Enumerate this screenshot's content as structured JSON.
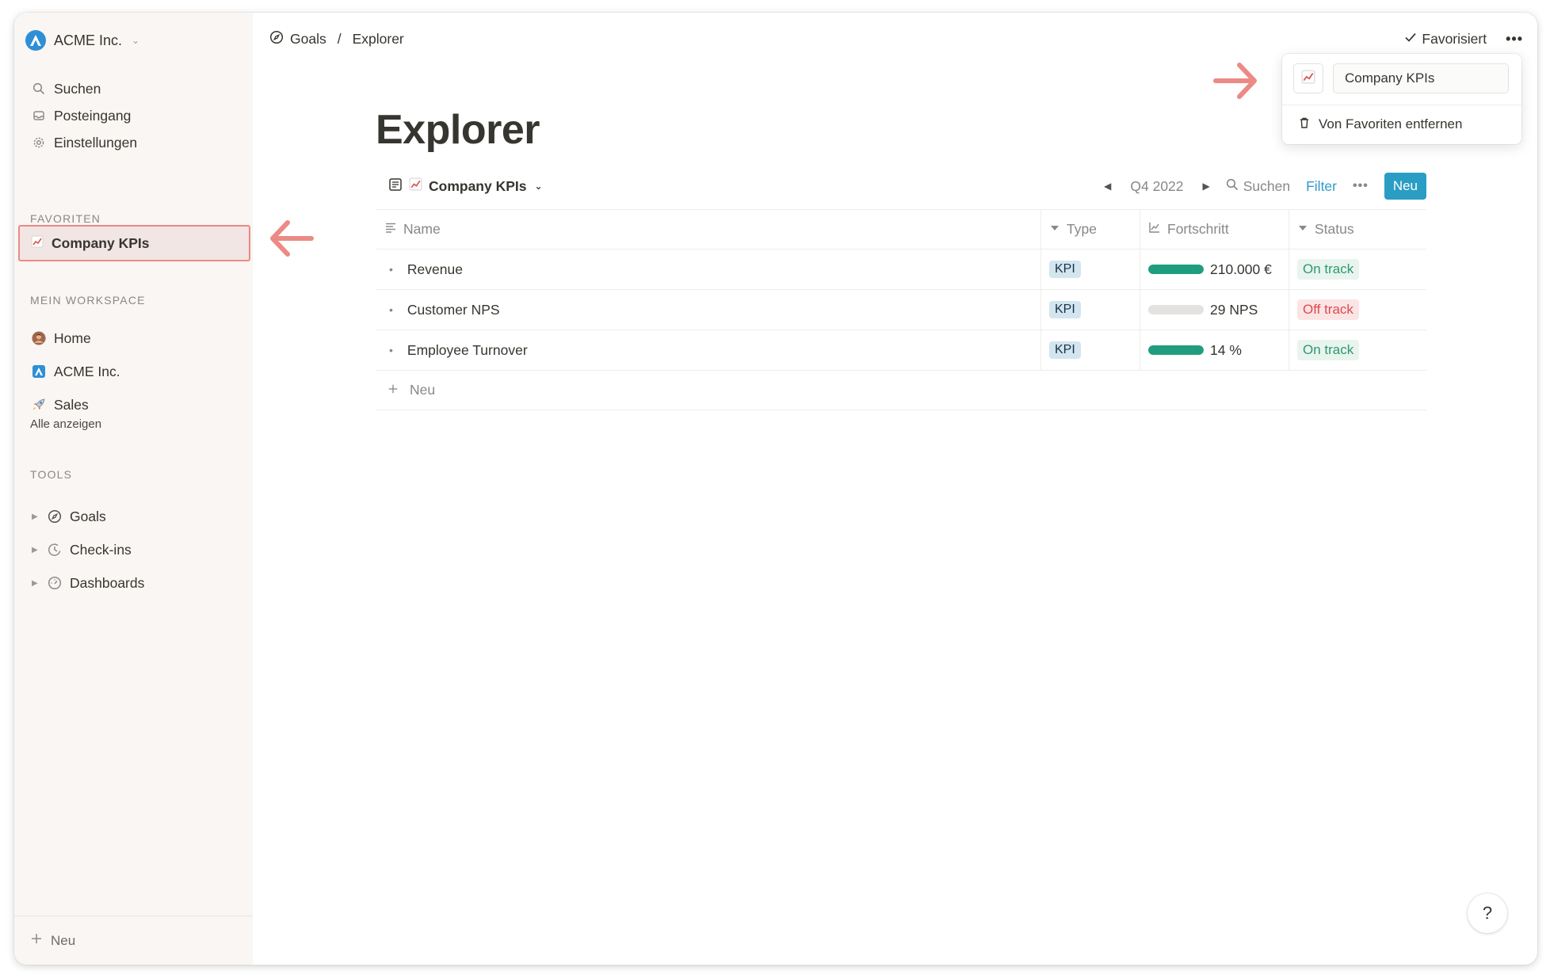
{
  "workspace": {
    "name": "ACME Inc.",
    "logo_letter": "A"
  },
  "sidebar": {
    "nav": [
      {
        "label": "Suchen",
        "icon": "search-icon"
      },
      {
        "label": "Posteingang",
        "icon": "inbox-icon"
      },
      {
        "label": "Einstellungen",
        "icon": "gear-icon"
      }
    ],
    "favorites_label": "FAVORITEN",
    "favorites": [
      {
        "label": "Company KPIs",
        "icon": "chart-up-icon"
      }
    ],
    "workspace_label": "MEIN WORKSPACE",
    "workspace_items": [
      {
        "label": "Home",
        "icon": "avatar-icon"
      },
      {
        "label": "ACME Inc.",
        "icon": "acme-logo-icon"
      },
      {
        "label": "Sales",
        "icon": "rocket-icon"
      }
    ],
    "show_all": "Alle anzeigen",
    "tools_label": "TOOLS",
    "tools": [
      {
        "label": "Goals",
        "icon": "compass-icon"
      },
      {
        "label": "Check-ins",
        "icon": "clock-icon"
      },
      {
        "label": "Dashboards",
        "icon": "gauge-icon"
      }
    ],
    "new_label": "Neu"
  },
  "header": {
    "breadcrumb": [
      {
        "label": "Goals",
        "icon": "compass-icon"
      },
      {
        "label": "Explorer"
      }
    ],
    "separator": "/",
    "favorited_label": "Favorisiert"
  },
  "popover": {
    "name_value": "Company KPIs",
    "remove_label": "Von Favoriten entfernen"
  },
  "page": {
    "title": "Explorer",
    "view_name": "Company KPIs",
    "period": "Q4 2022",
    "search_label": "Suchen",
    "filter_label": "Filter",
    "new_label": "Neu"
  },
  "table": {
    "columns": [
      {
        "label": "Name",
        "icon": "lines-icon"
      },
      {
        "label": "Type",
        "icon": "triangle-down-icon"
      },
      {
        "label": "Fortschritt",
        "icon": "line-chart-icon"
      },
      {
        "label": "Status",
        "icon": "triangle-down-icon"
      }
    ],
    "rows": [
      {
        "name": "Revenue",
        "type": "KPI",
        "progress_label": "210.000 €",
        "progress": 1.0,
        "status": "On track",
        "status_kind": "on"
      },
      {
        "name": "Customer NPS",
        "type": "KPI",
        "progress_label": "29 NPS",
        "progress": 0.0,
        "status": "Off track",
        "status_kind": "off"
      },
      {
        "name": "Employee Turnover",
        "type": "KPI",
        "progress_label": "14 %",
        "progress": 1.0,
        "status": "On track",
        "status_kind": "on"
      }
    ],
    "add_label": "Neu"
  },
  "help_label": "?",
  "colors": {
    "accent": "#2a9dc4",
    "progress_fill": "#1f9e7f",
    "on_track": "#2b9a6f",
    "off_track": "#dd4a50",
    "highlight_border": "#ec8a85",
    "annotation_arrow": "#ec8a85"
  }
}
